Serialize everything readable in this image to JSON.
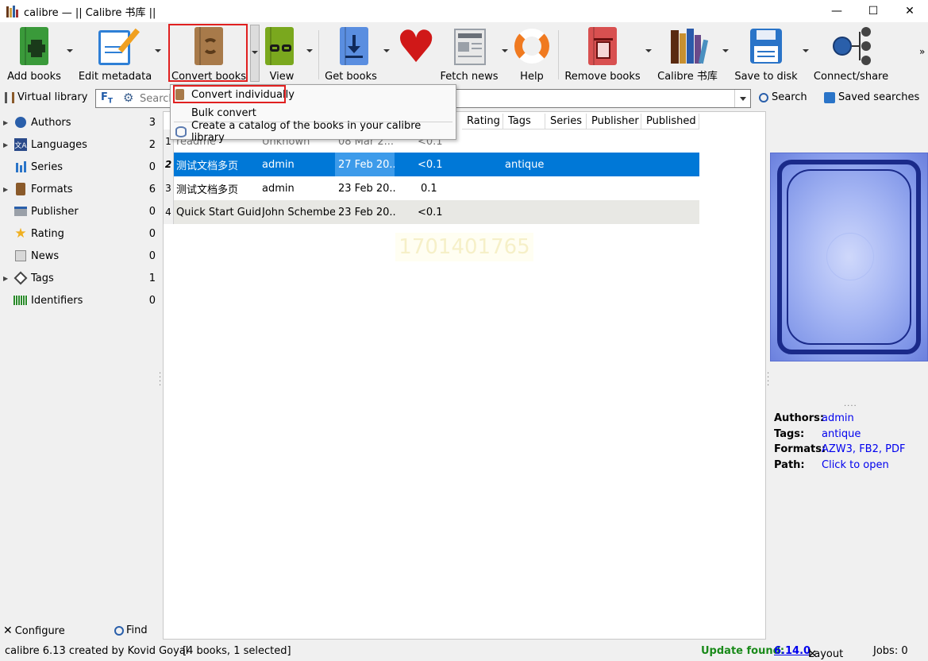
{
  "window": {
    "title": "calibre — || Calibre 书库 ||",
    "minimize": "—",
    "maximize": "☐",
    "close": "✕"
  },
  "toolbar": {
    "buttons": [
      {
        "label": "Add books",
        "icon": "add-book-icon",
        "color": "#3a9a3a"
      },
      {
        "label": "Edit metadata",
        "icon": "edit-metadata-icon",
        "color": "#2e7fd6"
      },
      {
        "label": "Convert books",
        "icon": "convert-books-icon",
        "color": "#a87a4a"
      },
      {
        "label": "View",
        "icon": "view-book-icon",
        "color": "#7aa81e"
      },
      {
        "label": "Get books",
        "icon": "get-books-icon",
        "color": "#5a8ee0"
      },
      {
        "label": "",
        "icon": "heart-icon",
        "color": "#d01818"
      },
      {
        "label": "Fetch news",
        "icon": "news-icon",
        "color": "#9aa0a8"
      },
      {
        "label": "Help",
        "icon": "lifebuoy-icon",
        "color": "#f07a20"
      },
      {
        "label": "Remove books",
        "icon": "remove-books-icon",
        "color": "#d85050"
      },
      {
        "label": "Calibre 书库",
        "icon": "library-icon",
        "color": "#6a4a8a"
      },
      {
        "label": "Save to disk",
        "icon": "save-disk-icon",
        "color": "#2a74c8"
      },
      {
        "label": "Connect/share",
        "icon": "connect-share-icon",
        "color": "#2a5faa"
      }
    ]
  },
  "menu": {
    "items": [
      {
        "label": "Convert individually"
      },
      {
        "label": "Bulk convert"
      },
      {
        "label": "Create a catalog of the books in your calibre library"
      }
    ]
  },
  "searchbar": {
    "virtual_library": "Virtual library",
    "placeholder": "Search",
    "search_button": "Search",
    "saved_searches": "Saved searches"
  },
  "tag_browser": {
    "items": [
      {
        "name": "Authors",
        "count": "3",
        "expandable": true,
        "icon": "authors-icon"
      },
      {
        "name": "Languages",
        "count": "2",
        "expandable": true,
        "icon": "languages-icon"
      },
      {
        "name": "Series",
        "count": "0",
        "expandable": false,
        "icon": "series-icon"
      },
      {
        "name": "Formats",
        "count": "6",
        "expandable": true,
        "icon": "formats-icon"
      },
      {
        "name": "Publisher",
        "count": "0",
        "expandable": false,
        "icon": "publisher-icon"
      },
      {
        "name": "Rating",
        "count": "0",
        "expandable": false,
        "icon": "rating-star-icon"
      },
      {
        "name": "News",
        "count": "0",
        "expandable": false,
        "icon": "news-icon"
      },
      {
        "name": "Tags",
        "count": "1",
        "expandable": true,
        "icon": "tags-icon"
      },
      {
        "name": "Identifiers",
        "count": "0",
        "expandable": false,
        "icon": "identifiers-barcode-icon"
      }
    ],
    "configure": "Configure",
    "find": "Find"
  },
  "book_list": {
    "columns": [
      "Rating",
      "Tags",
      "Series",
      "Publisher",
      "Published"
    ],
    "rows": [
      {
        "num": "1",
        "title": "readme",
        "author": "Unknown",
        "date": "08 Mar 2...",
        "size": "<0.1",
        "tags": ""
      },
      {
        "num": "2",
        "title": "测试文档多页",
        "author": "admin",
        "date": "27 Feb 20...",
        "size": "<0.1",
        "tags": "antique"
      },
      {
        "num": "3",
        "title": "测试文档多页",
        "author": "admin",
        "date": "23 Feb 20...",
        "size": "0.1",
        "tags": ""
      },
      {
        "num": "4",
        "title": "Quick Start Guide",
        "author": "John Schember",
        "date": "23 Feb 20...",
        "size": "<0.1",
        "tags": ""
      }
    ],
    "selected_row": 1,
    "watermark": "1701401765"
  },
  "details": {
    "authors_label": "Authors:",
    "authors": "admin",
    "tags_label": "Tags:",
    "tags": "antique",
    "formats_label": "Formats:",
    "formats": "AZW3, FB2, PDF",
    "path_label": "Path:",
    "path": "Click to open"
  },
  "status": {
    "left": "calibre 6.13 created by Kovid Goyal",
    "books": "[4 books, 1 selected]",
    "update_label": "Update found:",
    "update_version": "6.14.0",
    "layout": "Layout",
    "jobs": "Jobs: 0"
  },
  "colors": {
    "selection": "#0078d7",
    "selection_light": "#3d9bea",
    "highlight_border": "#e02020",
    "update_green": "#1a8a1a",
    "link": "#0000ee"
  }
}
